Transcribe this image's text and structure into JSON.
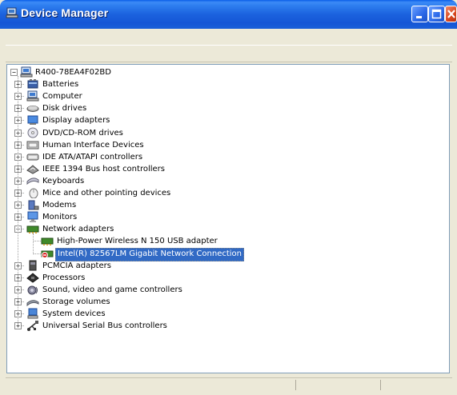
{
  "window": {
    "title": "Device Manager",
    "accent": "#1b62de",
    "selection_color": "#316ac5",
    "controls": [
      "minimize-icon",
      "maximize-icon",
      "close-icon"
    ]
  },
  "tree": {
    "root": {
      "label": "R400-78EA4F02BD",
      "icon": "computer-icon",
      "expanded": true
    },
    "categories": [
      {
        "label": "Batteries",
        "icon": "battery-icon",
        "expanded": false
      },
      {
        "label": "Computer",
        "icon": "computer-icon",
        "expanded": false
      },
      {
        "label": "Disk drives",
        "icon": "disk-drive-icon",
        "expanded": false
      },
      {
        "label": "Display adapters",
        "icon": "display-adapter-icon",
        "expanded": false
      },
      {
        "label": "DVD/CD-ROM drives",
        "icon": "dvd-icon",
        "expanded": false
      },
      {
        "label": "Human Interface Devices",
        "icon": "hid-icon",
        "expanded": false
      },
      {
        "label": "IDE ATA/ATAPI controllers",
        "icon": "ide-icon",
        "expanded": false
      },
      {
        "label": "IEEE 1394 Bus host controllers",
        "icon": "ieee1394-icon",
        "expanded": false
      },
      {
        "label": "Keyboards",
        "icon": "keyboard-icon",
        "expanded": false
      },
      {
        "label": "Mice and other pointing devices",
        "icon": "mouse-icon",
        "expanded": false
      },
      {
        "label": "Modems",
        "icon": "modem-icon",
        "expanded": false
      },
      {
        "label": "Monitors",
        "icon": "monitor-icon",
        "expanded": false
      },
      {
        "label": "Network adapters",
        "icon": "network-adapter-icon",
        "expanded": true,
        "children": [
          {
            "label": "High-Power Wireless N 150 USB adapter",
            "icon": "network-card-icon",
            "selected": false
          },
          {
            "label": "Intel(R) 82567LM Gigabit Network Connection",
            "icon": "network-card-disabled-icon",
            "selected": true
          }
        ]
      },
      {
        "label": "PCMCIA adapters",
        "icon": "pcmcia-icon",
        "expanded": false
      },
      {
        "label": "Processors",
        "icon": "processor-icon",
        "expanded": false
      },
      {
        "label": "Sound, video and game controllers",
        "icon": "sound-icon",
        "expanded": false
      },
      {
        "label": "Storage volumes",
        "icon": "storage-icon",
        "expanded": false
      },
      {
        "label": "System devices",
        "icon": "system-device-icon",
        "expanded": false
      },
      {
        "label": "Universal Serial Bus controllers",
        "icon": "usb-icon",
        "expanded": false
      }
    ]
  }
}
